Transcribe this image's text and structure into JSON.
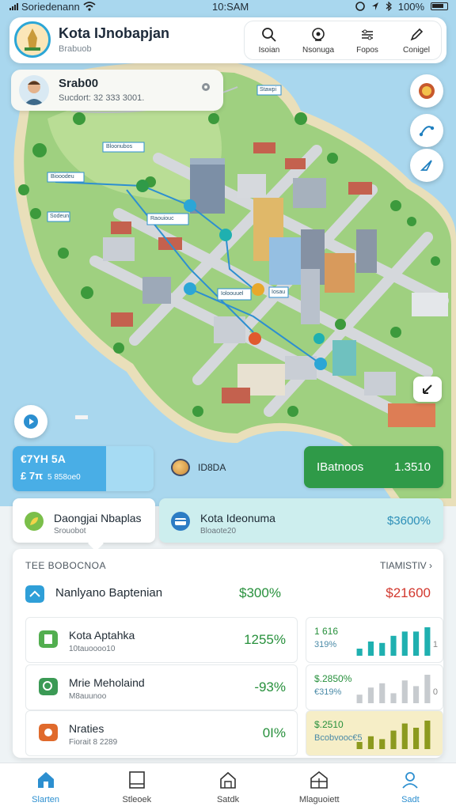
{
  "status_bar": {
    "carrier": "Soriedenann",
    "time": "10:SAM",
    "battery": "100%"
  },
  "header": {
    "title": "Kota IJnobapjan",
    "subtitle": "Brabuob",
    "actions": [
      {
        "label": "Isoian",
        "icon": "search-icon"
      },
      {
        "label": "Nsonuga",
        "icon": "location-icon"
      },
      {
        "label": "Fopos",
        "icon": "filter-icon"
      },
      {
        "label": "Conigel",
        "icon": "pen-icon"
      }
    ]
  },
  "user": {
    "name": "Srab00",
    "stats": "Sucdort: 32 333 3001."
  },
  "map_labels": {
    "tag1": "Stawpi",
    "tag2": "Bloonubos",
    "tag3": "Biooodeu",
    "tag4": "Sodeun",
    "tag5": "Raouiouc",
    "tag6": "Ioloouuel",
    "tag7": "Iosau"
  },
  "stats": {
    "blue_value": "€7YH 5A",
    "blue_sub_value": "£ 7π",
    "blue_sub_label": "5 858oe0",
    "mid_label": "ID8DA",
    "green_label": "IBatnoos",
    "green_value": "1.3510"
  },
  "districts": [
    {
      "name": "Daongjai Nbaplas",
      "sub": "Srouobot",
      "color": "#7bbf4a"
    },
    {
      "name": "Kota Ideonuma",
      "sub": "Bloaote20",
      "value": "$3600%",
      "color": "#2c7cc4"
    }
  ],
  "panel": {
    "heading": "TEE BOBOCNOA",
    "link": "TIAMISTIV",
    "top_row": {
      "name": "Nanlyano Baptenian",
      "value1": "$300%",
      "value2": "$21600"
    },
    "rows": [
      {
        "name": "Kota Aptahka",
        "sub": "10tauoooo10",
        "value": "1255%",
        "icon_color": "#52ae4f"
      },
      {
        "name": "Mrie Meholaind",
        "sub": "M8auunoo",
        "value": "-93%",
        "icon_color": "#3b9a55"
      },
      {
        "name": "Nraties",
        "sub": "Fiorait 8 2289",
        "value": "0I%",
        "icon_color": "#e06a2c"
      }
    ],
    "charts": [
      {
        "t1": "1 616",
        "t2": "319%",
        "end": "1",
        "bars": [
          0.25,
          0.5,
          0.45,
          0.7,
          0.85,
          0.85,
          1.0
        ],
        "color": "#1fb0b0",
        "bg": "#ffffff",
        "t1_color": "#27903c"
      },
      {
        "t1": "$.2850%",
        "t2": "€319%",
        "end": "0",
        "bars": [
          0.3,
          0.55,
          0.7,
          0.35,
          0.8,
          0.6,
          1.0
        ],
        "color": "#c7cbcf",
        "bg": "#ffffff",
        "t1_color": "#27903c"
      },
      {
        "t1": "$.2510",
        "t2": "Bcobvooc€5",
        "end": "",
        "bars": [
          0.25,
          0.45,
          0.35,
          0.65,
          0.9,
          0.75,
          1.0
        ],
        "color": "#8c9a1e",
        "bg": "#f6eec7",
        "t1_color": "#27903c"
      }
    ]
  },
  "tabs": [
    {
      "label": "Slarten",
      "icon": "home-icon",
      "active": true
    },
    {
      "label": "Stleoek",
      "icon": "card-icon",
      "active": false
    },
    {
      "label": "Satdk",
      "icon": "house-icon",
      "active": false
    },
    {
      "label": "Mlaguoiett",
      "icon": "building-icon",
      "active": false
    },
    {
      "label": "Sadt",
      "icon": "person-icon",
      "active": true
    }
  ]
}
